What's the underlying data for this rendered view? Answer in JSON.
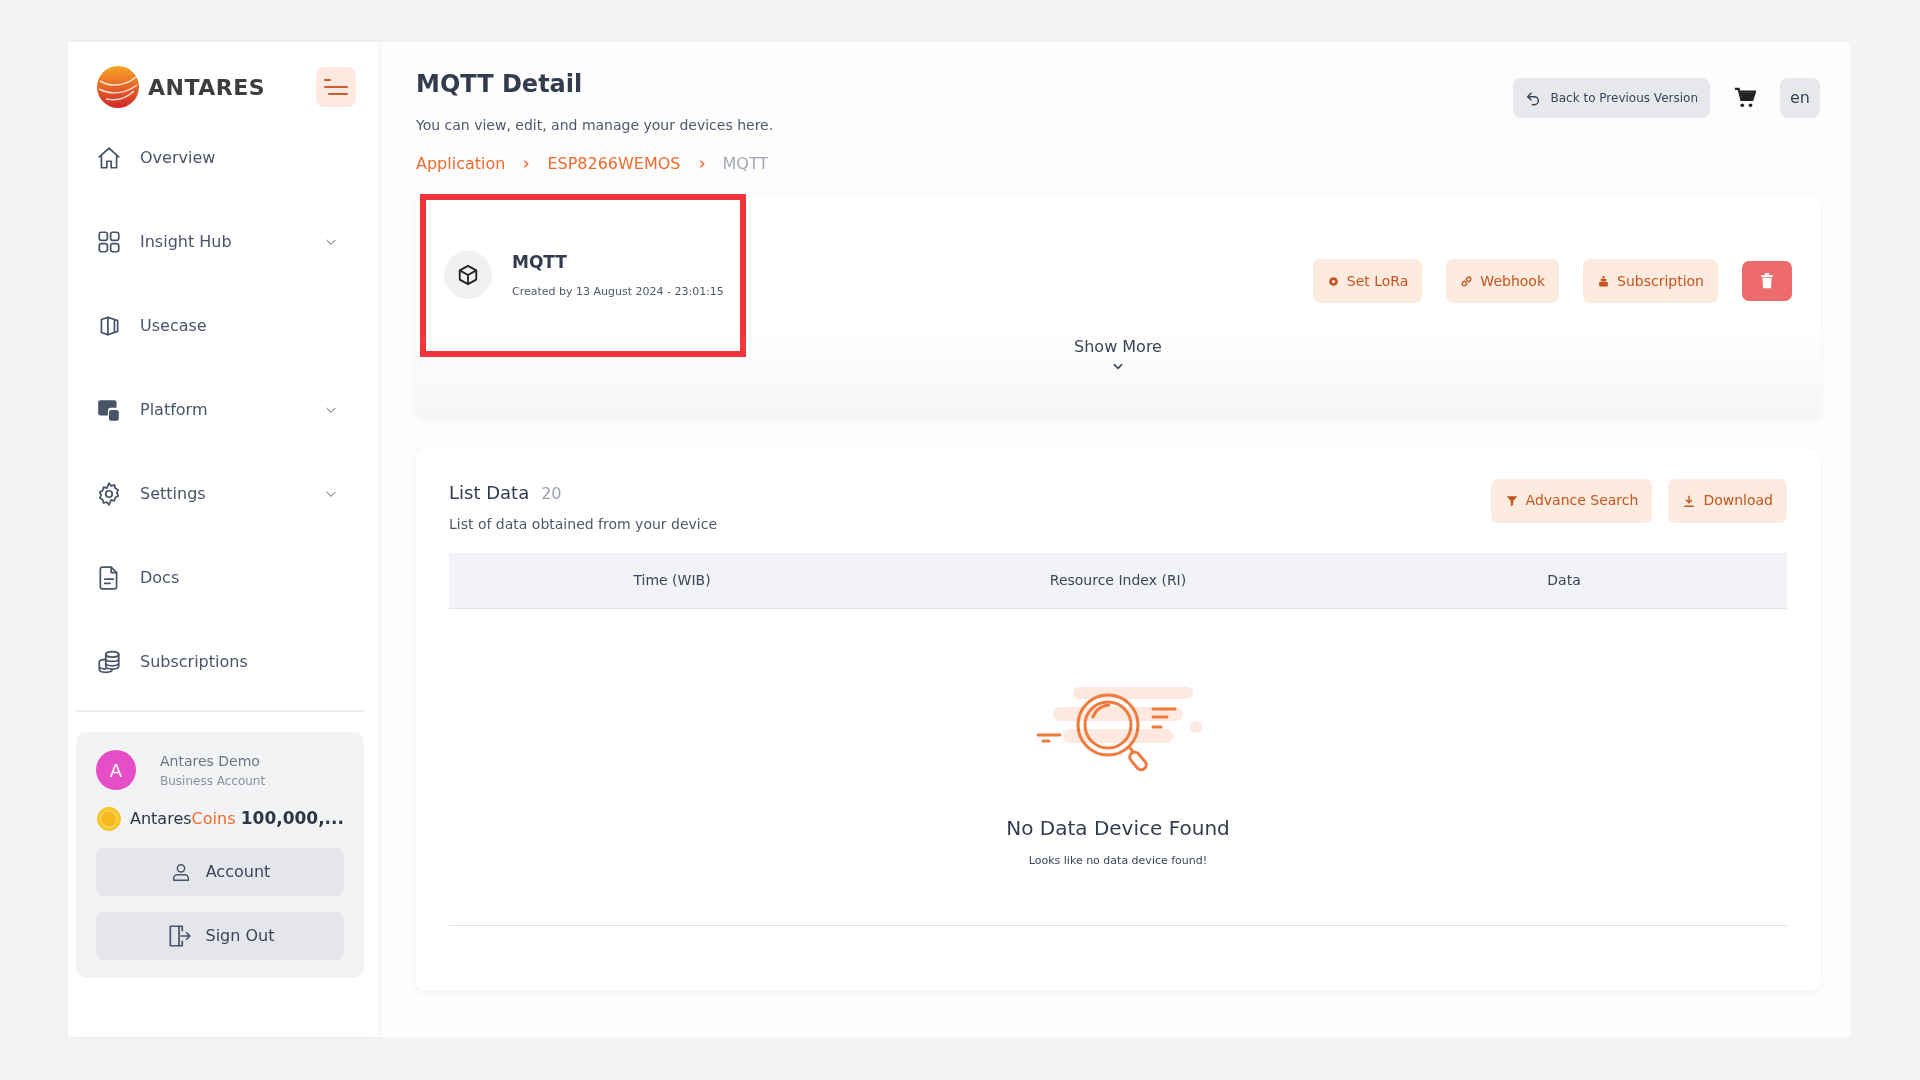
{
  "sidebar": {
    "brand": "ANTARES",
    "items": [
      {
        "label": "Overview",
        "has_submenu": false
      },
      {
        "label": "Insight Hub",
        "has_submenu": true
      },
      {
        "label": "Usecase",
        "has_submenu": false
      },
      {
        "label": "Platform",
        "has_submenu": true
      },
      {
        "label": "Settings",
        "has_submenu": true
      },
      {
        "label": "Docs",
        "has_submenu": false
      },
      {
        "label": "Subscriptions",
        "has_submenu": false
      }
    ],
    "user": {
      "initial": "A",
      "name": "Antares Demo",
      "account_type": "Business Account"
    },
    "coins": {
      "label": "Antares",
      "label_accent": "Coins",
      "amount": "100,000,..."
    },
    "buttons": [
      "Account",
      "Sign Out"
    ]
  },
  "header": {
    "title": "MQTT Detail",
    "subtitle": "You can view, edit, and manage your devices here.",
    "breadcrumb": [
      {
        "label": "Application",
        "current": false
      },
      {
        "label": "ESP8266WEMOS",
        "current": false
      },
      {
        "label": "MQTT",
        "current": true
      }
    ],
    "back_button": "Back to Previous Version",
    "language": "en"
  },
  "device": {
    "name": "MQTT",
    "created": "Created by 13 August 2024 - 23:01:15",
    "highlighted": true,
    "actions": [
      "Set LoRa",
      "Webhook",
      "Subscription"
    ],
    "show_more": "Show More"
  },
  "list": {
    "title": "List Data",
    "count": "20",
    "subtitle": "List of data obtained from your device",
    "actions": [
      "Advance Search",
      "Download"
    ],
    "columns": [
      "Time (WIB)",
      "Resource Index (RI)",
      "Data"
    ],
    "empty_title": "No Data Device Found",
    "empty_text": "Looks like no data device found!"
  }
}
